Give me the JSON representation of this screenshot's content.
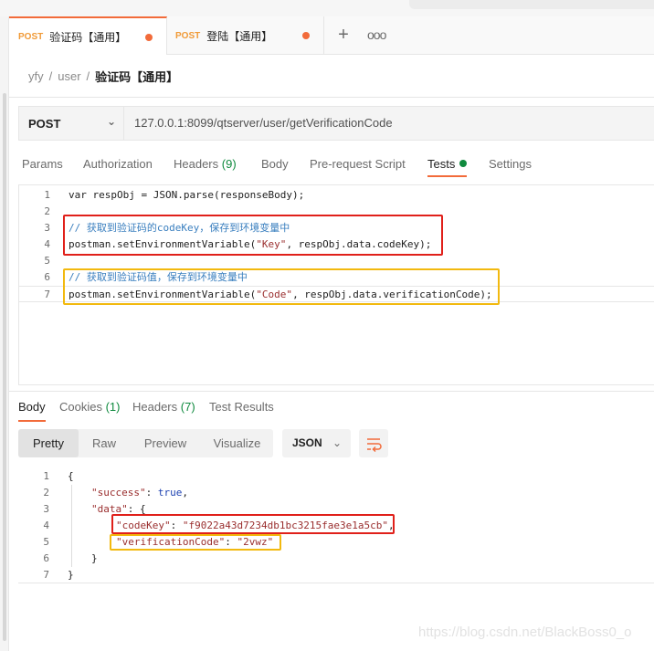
{
  "tabs": [
    {
      "method": "POST",
      "title": "验证码【通用】"
    },
    {
      "method": "POST",
      "title": "登陆【通用】"
    }
  ],
  "breadcrumb": [
    "yfy",
    "user",
    "验证码【通用】"
  ],
  "request": {
    "method": "POST",
    "url": "127.0.0.1:8099/qtserver/user/getVerificationCode"
  },
  "request_tabs": [
    "Params",
    "Authorization",
    "Headers",
    "(9)",
    "Body",
    "Pre-request Script",
    "Tests",
    "Settings"
  ],
  "editor_lines": [
    {
      "n": "1",
      "text": "var respObj = JSON.parse(responseBody);"
    },
    {
      "n": "2",
      "text": ""
    },
    {
      "n": "3",
      "text": "// 获取到验证码的codeKey，保存到环境变量中"
    },
    {
      "n": "4",
      "pre": "postman.setEnvironmentVariable(",
      "str": "\"Key\"",
      "post": ", respObj.data.codeKey);"
    },
    {
      "n": "5",
      "text": ""
    },
    {
      "n": "6",
      "text": "// 获取到验证码值，保存到环境变量中"
    },
    {
      "n": "7",
      "pre": "postman.setEnvironmentVariable(",
      "str": "\"Code\"",
      "post": ", respObj.data.verificationCode);"
    }
  ],
  "response_tabs": [
    "Body",
    "Cookies",
    "(1)",
    "Headers",
    "(7)",
    "Test Results"
  ],
  "view_modes": [
    "Pretty",
    "Raw",
    "Preview",
    "Visualize"
  ],
  "format": "JSON",
  "response_lines": [
    {
      "n": "1",
      "text": "{"
    },
    {
      "n": "2",
      "key": "\"success\"",
      "sep": ": ",
      "val": "true",
      "end": ","
    },
    {
      "n": "3",
      "key": "\"data\"",
      "sep": ": ",
      "end": "{"
    },
    {
      "n": "4",
      "key": "\"codeKey\"",
      "sep": ": ",
      "sval": "\"f9022a43d7234db1bc3215fae3e1a5cb\"",
      "end": ","
    },
    {
      "n": "5",
      "key": "\"verificationCode\"",
      "sep": ": ",
      "sval": "\"2vwz\"",
      "end": ""
    },
    {
      "n": "6",
      "text": "}"
    },
    {
      "n": "7",
      "text": "}"
    }
  ],
  "watermark": "https://blog.csdn.net/BlackBoss0_o",
  "colors": {
    "accent": "#f26b3a",
    "count_green": "#0f8a3e",
    "highlight_red": "#e0201a",
    "highlight_yellow": "#f2b90f"
  }
}
